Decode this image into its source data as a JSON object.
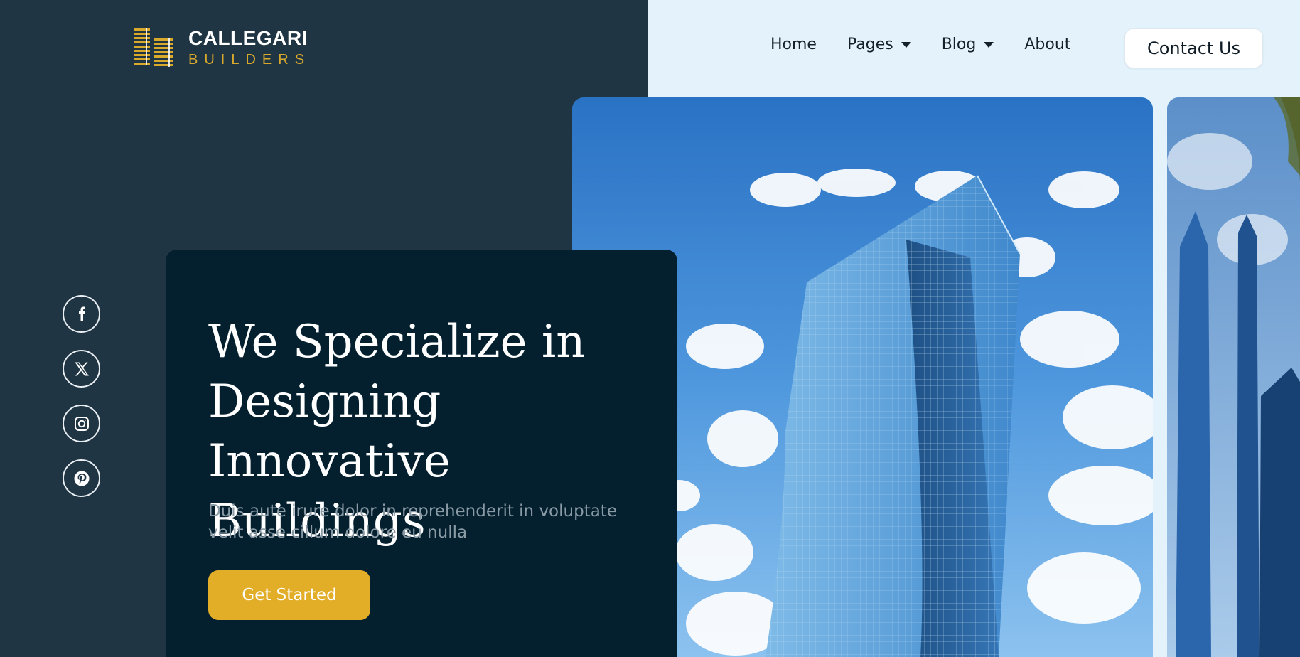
{
  "brand": {
    "name": "CALLEGARI",
    "tagline": "BUILDERS",
    "logo_icon": "buildings-logo-icon",
    "accent_color": "#d9a92c"
  },
  "nav": {
    "items": [
      {
        "label": "Home",
        "has_dropdown": false
      },
      {
        "label": "Pages",
        "has_dropdown": true
      },
      {
        "label": "Blog",
        "has_dropdown": true
      },
      {
        "label": "About",
        "has_dropdown": false
      }
    ],
    "contact_label": "Contact Us"
  },
  "social": [
    {
      "icon": "facebook-icon"
    },
    {
      "icon": "x-twitter-icon"
    },
    {
      "icon": "instagram-icon"
    },
    {
      "icon": "pinterest-icon"
    }
  ],
  "hero": {
    "title_lines": [
      "We Specialize in",
      "Designing Innovative",
      "Buildings"
    ],
    "subtitle": "Duis aute irure dolor in reprehenderit in voluptate velit asse cillum dolore eu nulla",
    "cta_label": "Get Started",
    "cta_color": "#e2ad27",
    "card_color": "#04202f"
  },
  "colors": {
    "left_panel": "#203544",
    "right_panel": "#e3f2fb"
  }
}
